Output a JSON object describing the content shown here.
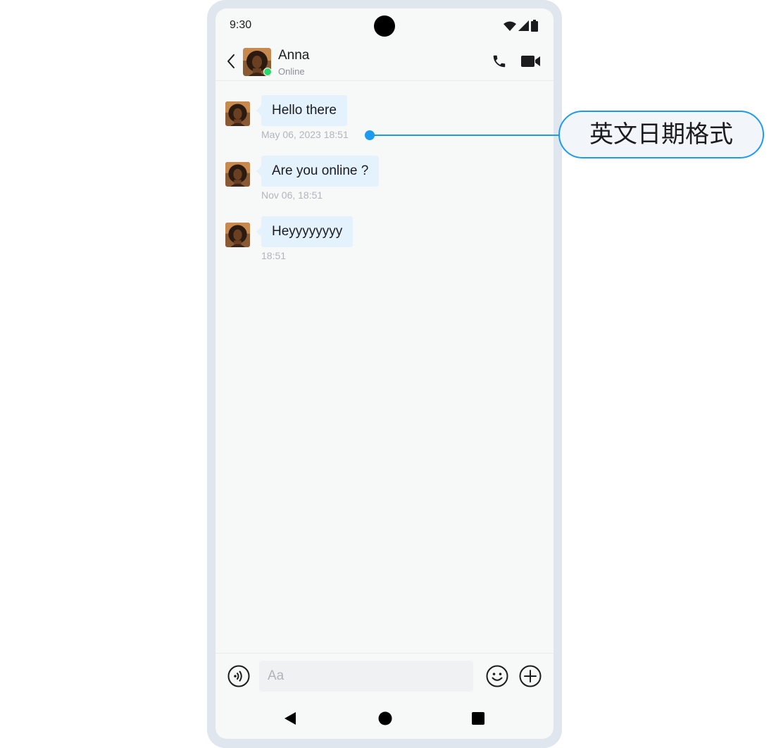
{
  "status_bar": {
    "time": "9:30"
  },
  "chat_header": {
    "contact_name": "Anna",
    "contact_status": "Online"
  },
  "messages": [
    {
      "text": "Hello there",
      "timestamp": "May 06, 2023 18:51"
    },
    {
      "text": "Are you online ?",
      "timestamp": "Nov 06, 18:51"
    },
    {
      "text": "Heyyyyyyyy",
      "timestamp": "18:51"
    }
  ],
  "input_bar": {
    "placeholder": "Aa"
  },
  "annotation": {
    "label": "英文日期格式"
  },
  "colors": {
    "bubble": "#e3f2fd",
    "online": "#2bd96a",
    "annotation_accent": "#1d9bf0",
    "frame": "#dfe6ee",
    "screen_background": "#f7f8f8"
  },
  "icons": [
    "back-arrow-icon",
    "phone-icon",
    "video-camera-icon",
    "voice-icon",
    "emoji-icon",
    "plus-icon",
    "nav-back-icon",
    "nav-home-icon",
    "nav-recents-icon",
    "wifi-icon",
    "signal-icon",
    "battery-icon"
  ]
}
